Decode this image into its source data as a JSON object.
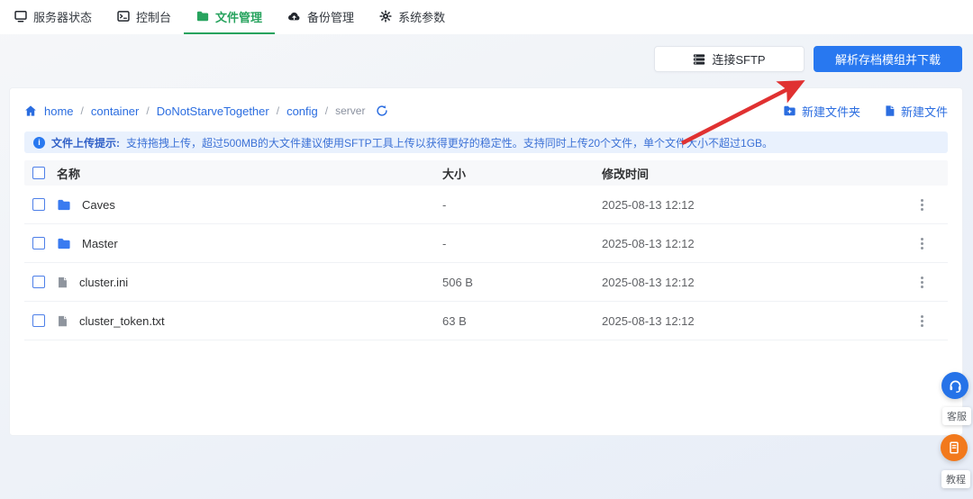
{
  "nav": {
    "tabs": [
      {
        "label": "服务器状态",
        "icon": "monitor-icon",
        "active": false
      },
      {
        "label": "控制台",
        "icon": "console-icon",
        "active": false
      },
      {
        "label": "文件管理",
        "icon": "folder-icon",
        "active": true
      },
      {
        "label": "备份管理",
        "icon": "cloud-backup-icon",
        "active": false
      },
      {
        "label": "系统参数",
        "icon": "gear-icon",
        "active": false
      }
    ]
  },
  "actions": {
    "connect_sftp_label": "连接SFTP",
    "parse_download_label": "解析存档模组并下载"
  },
  "breadcrumb": {
    "separator": "/",
    "links": [
      {
        "label": "home"
      },
      {
        "label": "container"
      },
      {
        "label": "DoNotStarveTogether"
      },
      {
        "label": "config"
      }
    ],
    "current": "server"
  },
  "file_actions": {
    "new_folder_label": "新建文件夹",
    "new_file_label": "新建文件"
  },
  "alert": {
    "title": "文件上传提示:",
    "text": "支持拖拽上传，超过500MB的大文件建议使用SFTP工具上传以获得更好的稳定性。支持同时上传20个文件，单个文件大小不超过1GB。"
  },
  "table": {
    "headers": {
      "name": "名称",
      "size": "大小",
      "modified": "修改时间"
    },
    "rows": [
      {
        "name": "Caves",
        "type": "folder",
        "size": "-",
        "modified": "2025-08-13 12:12"
      },
      {
        "name": "Master",
        "type": "folder",
        "size": "-",
        "modified": "2025-08-13 12:12"
      },
      {
        "name": "cluster.ini",
        "type": "file",
        "size": "506 B",
        "modified": "2025-08-13 12:12"
      },
      {
        "name": "cluster_token.txt",
        "type": "file",
        "size": "63 B",
        "modified": "2025-08-13 12:12"
      }
    ]
  },
  "floating": {
    "support_label": "客服",
    "tutorial_label": "教程"
  },
  "colors": {
    "primary_blue": "#2878f0",
    "active_green": "#27a35e",
    "link_blue": "#2b6de0",
    "accent_orange": "#f2791c",
    "arrow_red": "#e03131"
  }
}
